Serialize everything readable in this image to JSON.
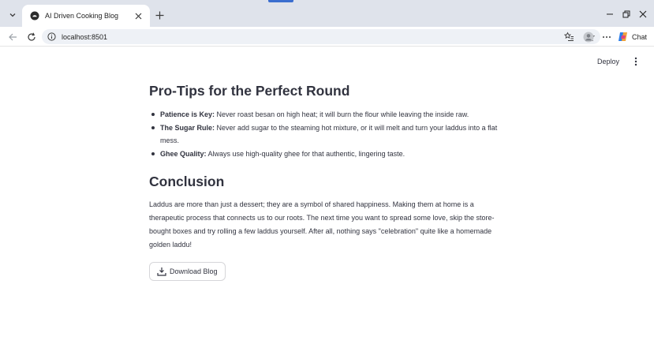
{
  "browser": {
    "tab_title": "AI Driven Cooking Blog",
    "url": "localhost:8501",
    "chat_label": "Chat",
    "icons": {
      "tab_menu": "chevron-down-icon",
      "favicon": "streamlit-favicon-icon",
      "tab_close": "close-icon",
      "new_tab": "plus-icon",
      "minimize": "minimize-icon",
      "maximize": "restore-icon",
      "close": "close-icon",
      "back": "arrow-left-icon",
      "reload": "reload-icon",
      "site_info": "info-icon",
      "bookmark": "star-icon",
      "favorites": "favorites-icon",
      "profile": "profile-icon",
      "more": "more-icon",
      "copilot": "copilot-icon"
    }
  },
  "app": {
    "deploy_label": "Deploy",
    "tips_heading": "Pro-Tips for the Perfect Round",
    "tips": [
      {
        "bold": "Patience is Key:",
        "text": " Never roast besan on high heat; it will burn the flour while leaving the inside raw."
      },
      {
        "bold": "The Sugar Rule:",
        "text": " Never add sugar to the steaming hot mixture, or it will melt and turn your laddus into a flat mess."
      },
      {
        "bold": "Ghee Quality:",
        "text": " Always use high-quality ghee for that authentic, lingering taste."
      }
    ],
    "conclusion_heading": "Conclusion",
    "conclusion_text": "Laddus are more than just a dessert; they are a symbol of shared happiness. Making them at home is a therapeutic process that connects us to our roots. The next time you want to spread some love, skip the store-bought boxes and try rolling a few laddus yourself. After all, nothing says \"celebration\" quite like a homemade golden laddu!",
    "download_label": "Download Blog",
    "colors": {
      "text": "#31333f",
      "chrome_bg": "#dfe3eb",
      "omnibox_bg": "#eef1f6"
    }
  }
}
